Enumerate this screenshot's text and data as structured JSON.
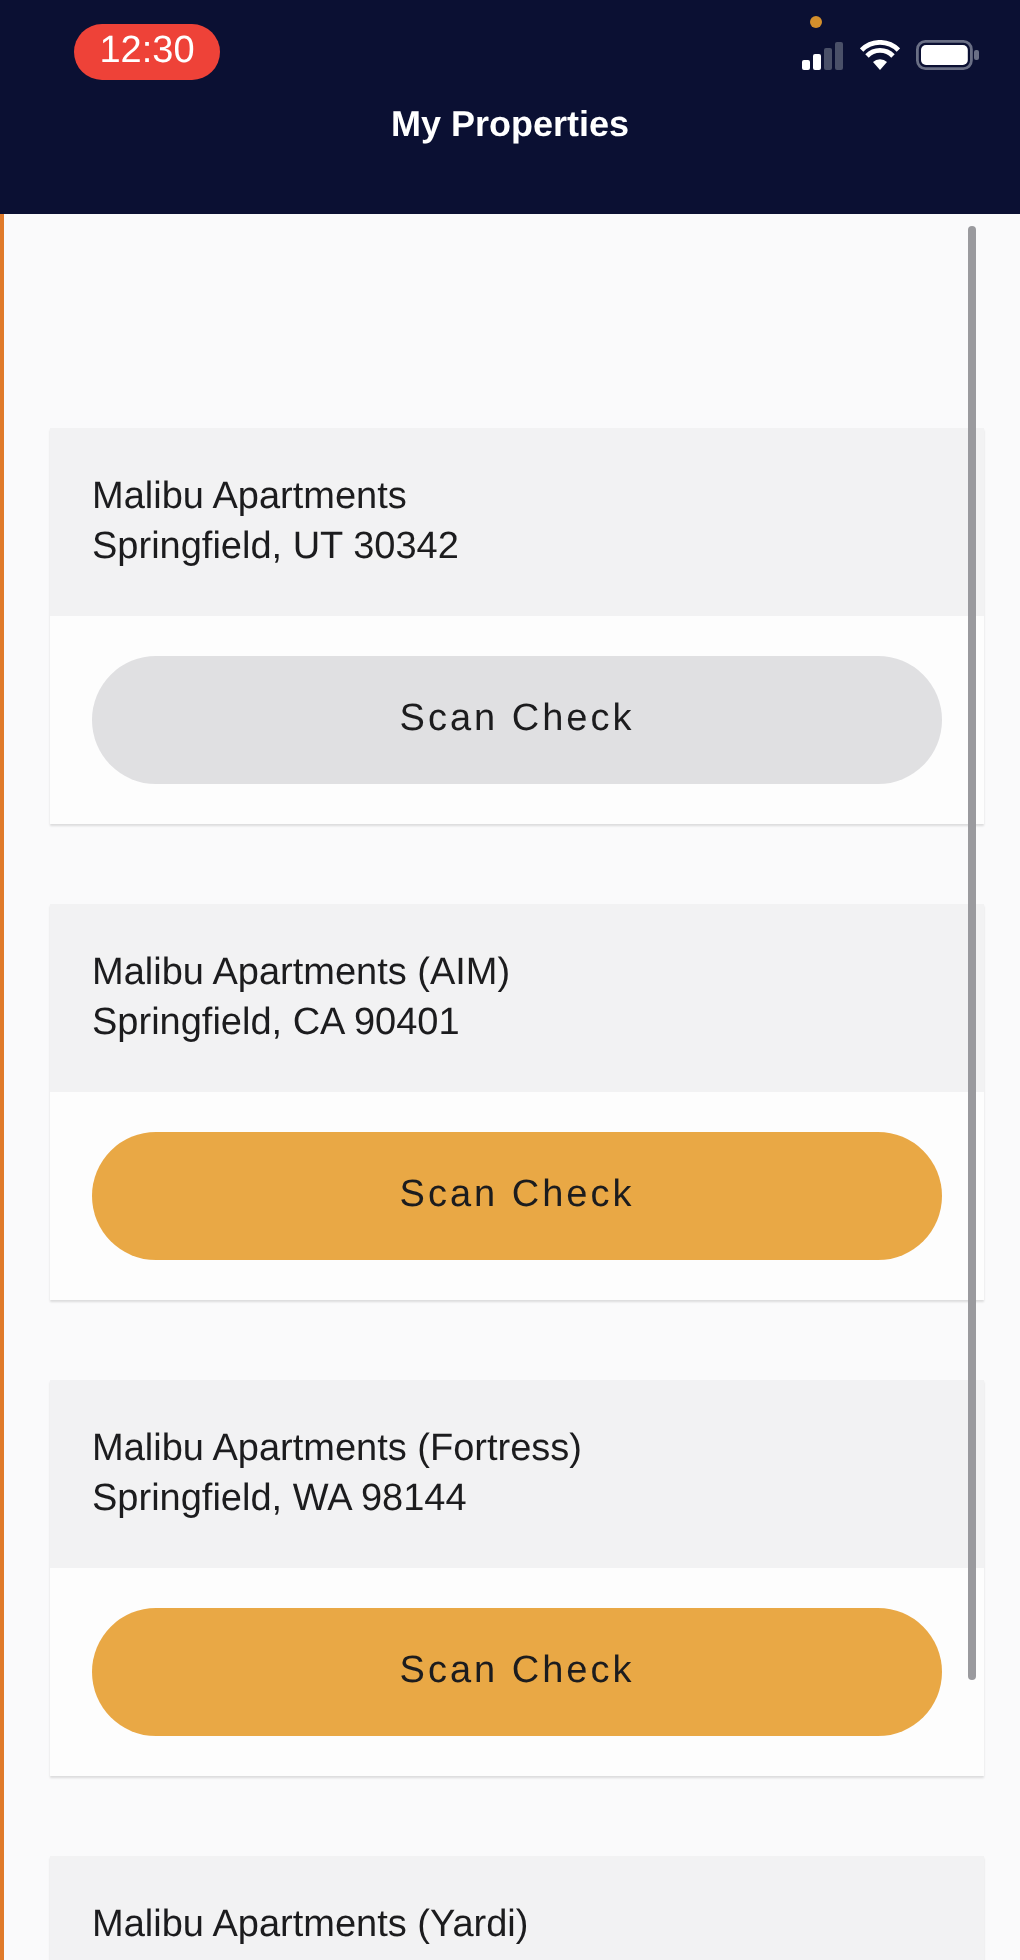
{
  "status_bar": {
    "time": "12:30"
  },
  "header": {
    "title": "My Properties"
  },
  "properties": [
    {
      "name": "Malibu Apartments",
      "address": "Springfield, UT 30342",
      "button": {
        "label": "Scan Check",
        "disabled": true
      }
    },
    {
      "name": "Malibu Apartments (AIM)",
      "address": "Springfield, CA 90401",
      "button": {
        "label": "Scan Check",
        "disabled": false
      }
    },
    {
      "name": "Malibu Apartments (Fortress)",
      "address": "Springfield, WA 98144",
      "button": {
        "label": "Scan Check",
        "disabled": false
      }
    },
    {
      "name": "Malibu Apartments (Yardi)"
    }
  ]
}
